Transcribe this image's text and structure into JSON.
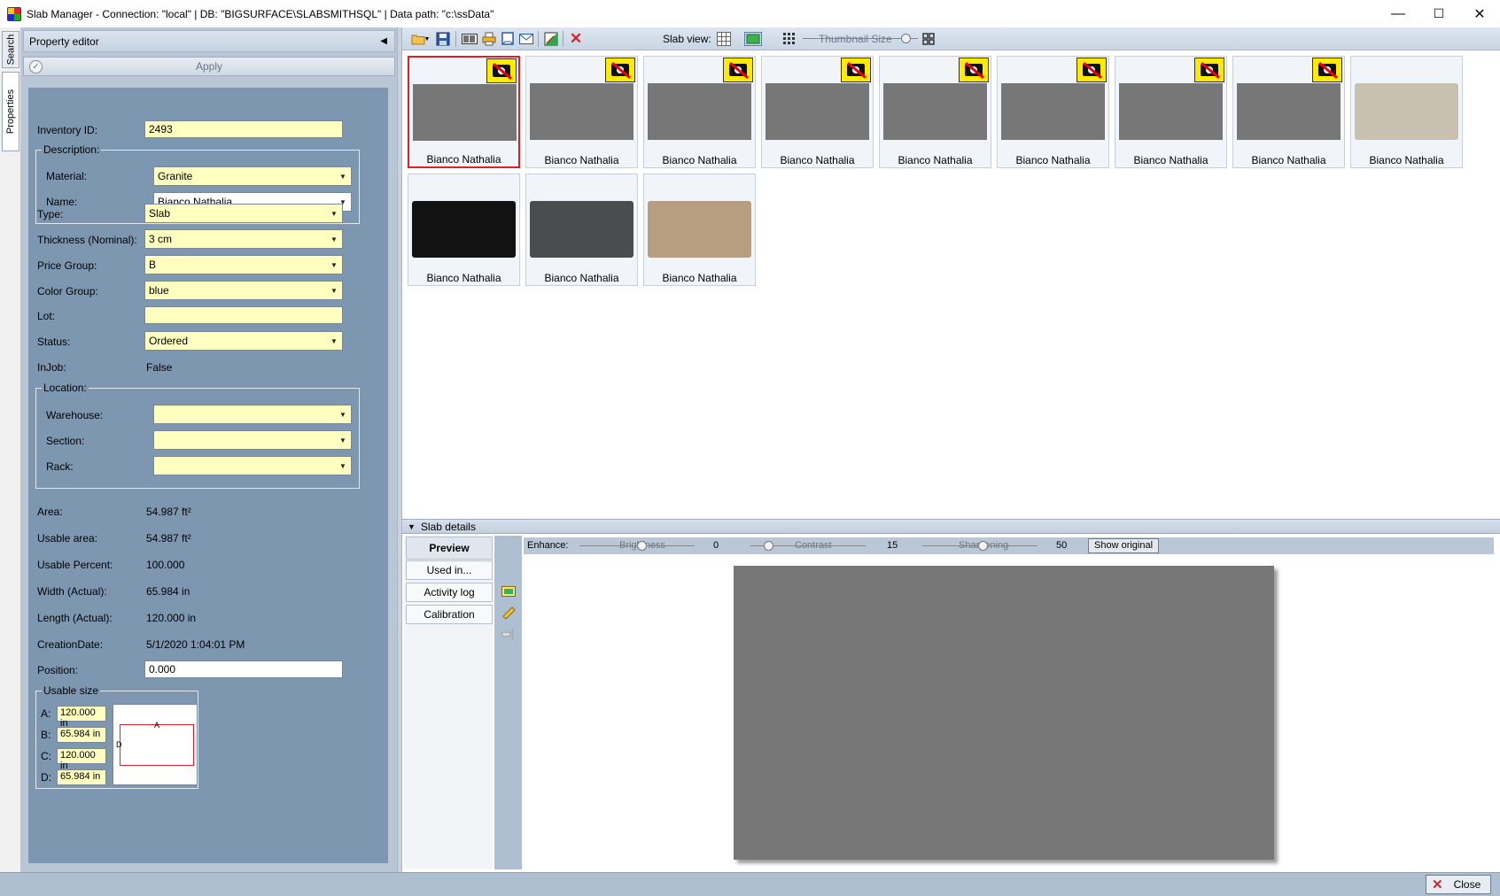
{
  "window": {
    "title": "Slab Manager -  Connection: \"local\"  |  DB: \"BIGSURFACE\\SLABSMITHSQL\"  |  Data path: \"c:\\ssData\"",
    "minimize": "—",
    "maximize": "☐",
    "close": "✕"
  },
  "side_tabs": {
    "search": "Search",
    "properties": "Properties"
  },
  "property_editor": {
    "header": "Property editor",
    "collapse_glyph": "◀",
    "apply_label": "Apply",
    "apply_glyph": "✓",
    "inventory_id_label": "Inventory ID:",
    "inventory_id": "2493",
    "description_group": "Description:",
    "material_label": "Material:",
    "material": "Granite",
    "name_label": "Name:",
    "name": "Bianco Nathalia",
    "type_label": "Type:",
    "type": "Slab",
    "thickness_label": "Thickness (Nominal):",
    "thickness": "3 cm",
    "price_group_label": "Price Group:",
    "price_group": "B",
    "color_group_label": "Color Group:",
    "color_group": "blue",
    "lot_label": "Lot:",
    "lot": "",
    "status_label": "Status:",
    "status": "Ordered",
    "injob_label": "InJob:",
    "injob": "False",
    "location_group": "Location:",
    "warehouse_label": "Warehouse:",
    "warehouse": "",
    "section_label": "Section:",
    "section": "",
    "rack_label": "Rack:",
    "rack": "",
    "area_label": "Area:",
    "area": "54.987 ft²",
    "usable_area_label": "Usable area:",
    "usable_area": "54.987 ft²",
    "usable_percent_label": "Usable Percent:",
    "usable_percent": "100.000",
    "width_label": "Width (Actual):",
    "width": "65.984 in",
    "length_label": "Length (Actual):",
    "length": "120.000 in",
    "creation_date_label": "CreationDate:",
    "creation_date": "5/1/2020 1:04:01 PM",
    "position_label": "Position:",
    "position": "0.000",
    "usable_size_group": "Usable size",
    "usable": {
      "a_label": "A:",
      "a": "120.000 in",
      "b_label": "B:",
      "b": "65.984 in",
      "c_label": "C:",
      "c": "120.000 in",
      "d_label": "D:",
      "d": "65.984 in",
      "preview_a": "A",
      "preview_d": "D"
    },
    "dropdown_glyph": "▼"
  },
  "toolbar": {
    "slab_view_label": "Slab view:",
    "thumbnail_size_label": "Thumbnail Size",
    "delete_glyph": "✕"
  },
  "tiles": [
    {
      "caption": "Bianco Nathalia",
      "has_image": false,
      "selected": true
    },
    {
      "caption": "Bianco Nathalia",
      "has_image": false,
      "selected": false
    },
    {
      "caption": "Bianco Nathalia",
      "has_image": false,
      "selected": false
    },
    {
      "caption": "Bianco Nathalia",
      "has_image": false,
      "selected": false
    },
    {
      "caption": "Bianco Nathalia",
      "has_image": false,
      "selected": false
    },
    {
      "caption": "Bianco Nathalia",
      "has_image": false,
      "selected": false
    },
    {
      "caption": "Bianco Nathalia",
      "has_image": false,
      "selected": false
    },
    {
      "caption": "Bianco Nathalia",
      "has_image": false,
      "selected": false
    },
    {
      "caption": "Bianco Nathalia",
      "has_image": true,
      "selected": false,
      "color": "#c9c1b0"
    },
    {
      "caption": "Bianco Nathalia",
      "has_image": true,
      "selected": false,
      "color": "#121212"
    },
    {
      "caption": "Bianco Nathalia",
      "has_image": true,
      "selected": false,
      "color": "#4b4c4e"
    },
    {
      "caption": "Bianco Nathalia",
      "has_image": true,
      "selected": false,
      "color": "#b79e80"
    }
  ],
  "slab_details": {
    "header": "Slab details",
    "header_glyph": "▼",
    "tabs": {
      "preview": "Preview",
      "used_in": "Used in...",
      "activity_log": "Activity log",
      "calibration": "Calibration"
    },
    "enhance_label": "Enhance:",
    "brightness_label": "Brightness",
    "brightness": "0",
    "contrast_label": "Contrast",
    "contrast": "15",
    "sharpening_label": "Sharpening",
    "sharpening": "50",
    "show_original": "Show original"
  },
  "status_bar": {
    "close_label": "Close",
    "close_glyph": "✕"
  },
  "colors": {
    "accent_red": "#d9232a",
    "placeholder_gray": "#777777",
    "field_yellow": "#ffffc0",
    "panel_blue": "#7d97b1"
  }
}
